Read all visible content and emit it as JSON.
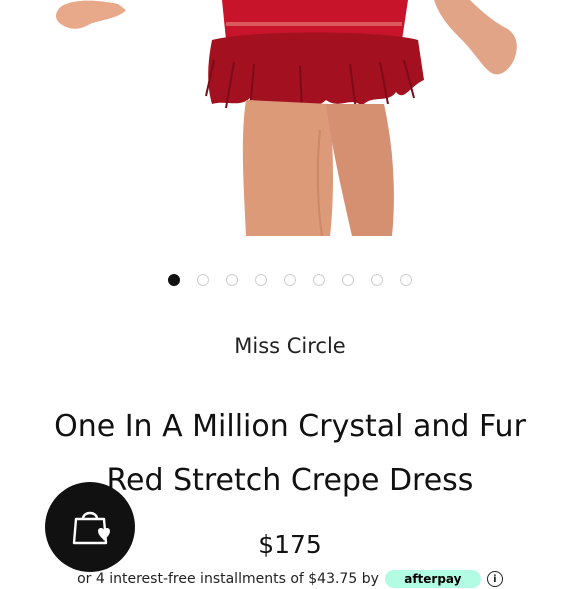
{
  "product": {
    "brand": "Miss Circle",
    "title_line1": "One In A Million Crystal and Fur",
    "title_line2": "Red Stretch Crepe Dress",
    "price": "$175",
    "image_alt": "Red crystal and feather dress product photo"
  },
  "gallery": {
    "total_images": 9,
    "active_index": 1
  },
  "installment": {
    "text": "or 4 interest-free installments of $43.75 by",
    "provider": "afterpay",
    "info_icon": "info-icon"
  },
  "cart_button": {
    "icon": "shopping-bag-heart-icon"
  },
  "colors": {
    "dress_red": "#c8142a",
    "dot_active": "#111111",
    "dot_inactive": "#cfcfcf",
    "fab_background": "#111111",
    "afterpay_mint": "#b2fce4"
  }
}
